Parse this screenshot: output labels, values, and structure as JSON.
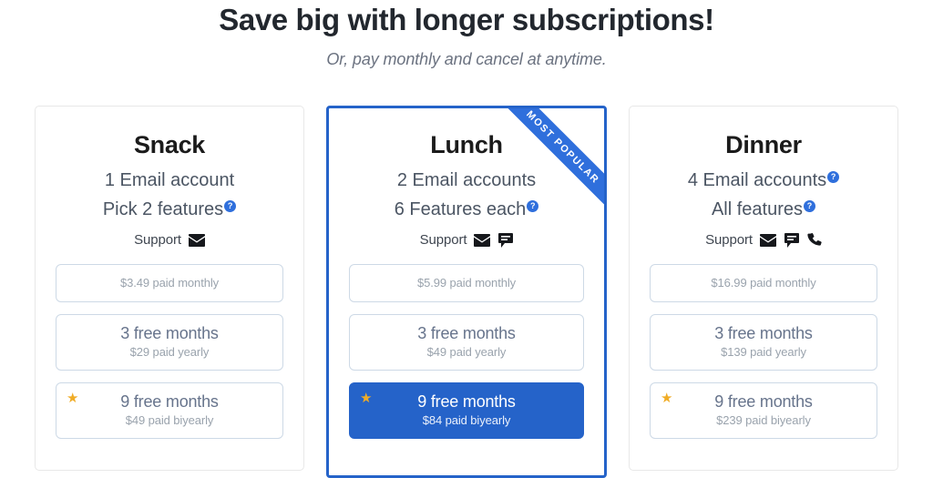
{
  "header": {
    "title": "Save big with longer subscriptions!",
    "subtitle": "Or, pay monthly and cancel at anytime."
  },
  "colors": {
    "accent_blue": "#2563c9",
    "ribbon_blue": "#2f6fdc",
    "star_amber": "#f0ac26",
    "muted_text": "#9aa3ad",
    "plan_text": "#67748c",
    "card_border": "#e8e8e8"
  },
  "help_icon_glyph": "?",
  "plans": [
    {
      "name": "Snack",
      "featured": false,
      "ribbon": null,
      "accounts": "1 Email account",
      "accounts_help": false,
      "features": "Pick 2 features",
      "features_help": true,
      "support_label": "Support",
      "support_icons": [
        "envelope-icon"
      ],
      "prices": [
        {
          "id": "monthly",
          "main": "$3.49 paid monthly",
          "sub": null,
          "selected": false,
          "star": false
        },
        {
          "id": "yearly",
          "main": "3 free months",
          "sub": "$29 paid yearly",
          "selected": false,
          "star": false
        },
        {
          "id": "biyearly",
          "main": "9 free months",
          "sub": "$49 paid biyearly",
          "selected": false,
          "star": true
        }
      ]
    },
    {
      "name": "Lunch",
      "featured": true,
      "ribbon": "MOST POPULAR",
      "accounts": "2 Email accounts",
      "accounts_help": false,
      "features": "6 Features each",
      "features_help": true,
      "support_label": "Support",
      "support_icons": [
        "envelope-icon",
        "chat-icon"
      ],
      "prices": [
        {
          "id": "monthly",
          "main": "$5.99 paid monthly",
          "sub": null,
          "selected": false,
          "star": false
        },
        {
          "id": "yearly",
          "main": "3 free months",
          "sub": "$49 paid yearly",
          "selected": false,
          "star": false
        },
        {
          "id": "biyearly",
          "main": "9 free months",
          "sub": "$84 paid biyearly",
          "selected": true,
          "star": true
        }
      ]
    },
    {
      "name": "Dinner",
      "featured": false,
      "ribbon": null,
      "accounts": "4 Email accounts",
      "accounts_help": true,
      "features": "All features",
      "features_help": true,
      "support_label": "Support",
      "support_icons": [
        "envelope-icon",
        "chat-icon",
        "phone-icon"
      ],
      "prices": [
        {
          "id": "monthly",
          "main": "$16.99 paid monthly",
          "sub": null,
          "selected": false,
          "star": false
        },
        {
          "id": "yearly",
          "main": "3 free months",
          "sub": "$139 paid yearly",
          "selected": false,
          "star": false
        },
        {
          "id": "biyearly",
          "main": "9 free months",
          "sub": "$239 paid biyearly",
          "selected": false,
          "star": true
        }
      ]
    }
  ]
}
